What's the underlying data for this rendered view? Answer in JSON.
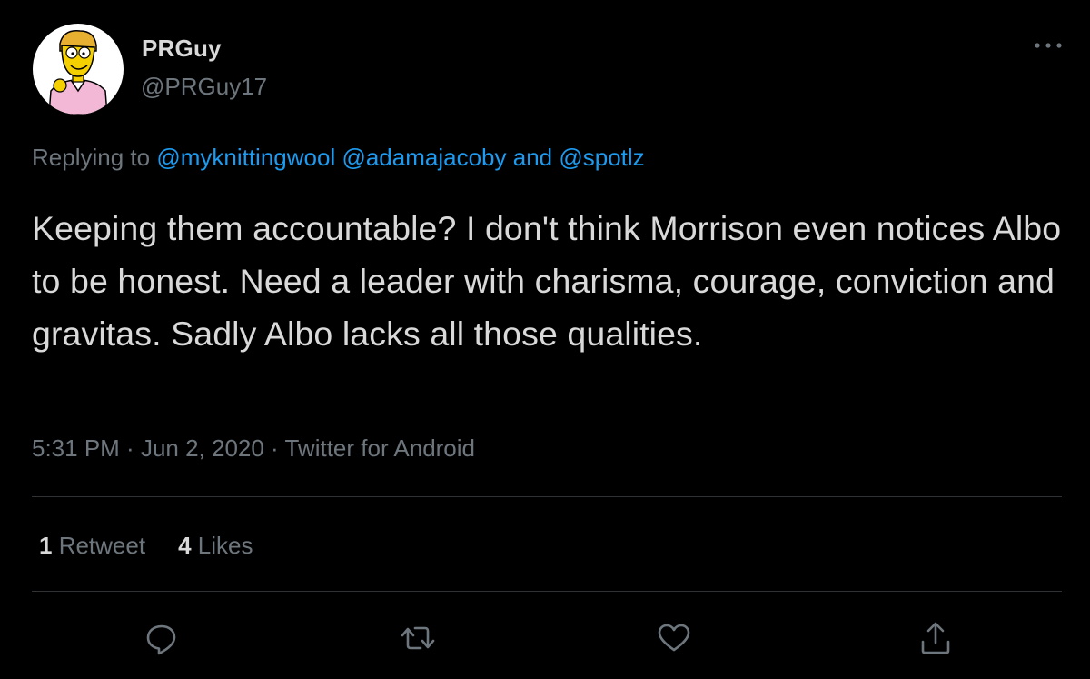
{
  "user": {
    "display_name": "PRGuy",
    "handle": "@PRGuy17",
    "avatar_icon": "cartoon-avatar-icon"
  },
  "reply": {
    "prefix": "Replying to ",
    "mention1": "@myknittingwool",
    "mention2": "@adamajacoby",
    "connector": " and ",
    "mention3": "@spotlz"
  },
  "tweet": {
    "text": "Keeping them accountable? I don't think Morrison even notices Albo to be honest. Need a leader with charisma, courage, conviction and gravitas. Sadly Albo lacks all those qualities."
  },
  "meta": {
    "time": "5:31 PM",
    "separator": " · ",
    "date": "Jun 2, 2020",
    "source": "Twitter for Android"
  },
  "stats": {
    "retweets_count": "1",
    "retweets_label": " Retweet",
    "likes_count": "4",
    "likes_label": " Likes"
  },
  "actions": {
    "reply_icon": "reply-icon",
    "retweet_icon": "retweet-icon",
    "like_icon": "heart-icon",
    "share_icon": "share-icon",
    "more_icon": "more-dots-icon"
  },
  "colors": {
    "background": "#000000",
    "text": "#d9d9d9",
    "secondary": "#6e767d",
    "link": "#1d9bf0",
    "divider": "#2f3336"
  }
}
